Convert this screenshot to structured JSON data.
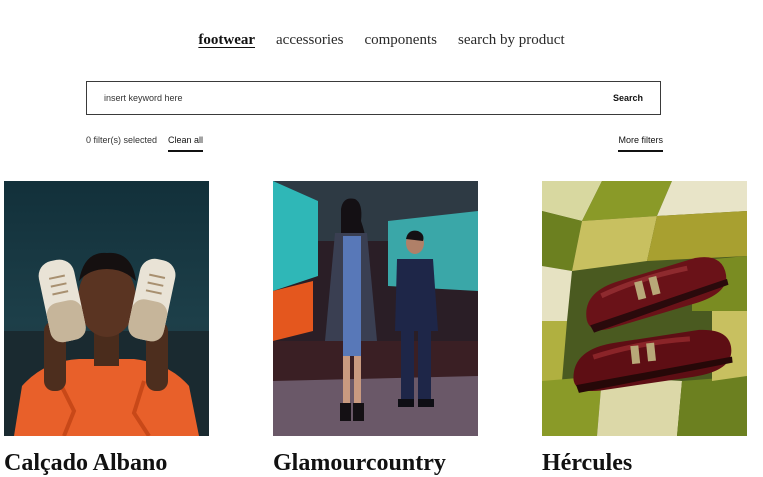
{
  "nav": {
    "items": [
      {
        "label": "footwear",
        "active": true
      },
      {
        "label": "accessories",
        "active": false
      },
      {
        "label": "components",
        "active": false
      },
      {
        "label": "search by product",
        "active": false
      }
    ]
  },
  "search": {
    "placeholder": "insert keyword here",
    "button_label": "Search"
  },
  "filters": {
    "selected_text": "0 filter(s) selected",
    "clean_all_label": "Clean all",
    "more_filters_label": "More filters"
  },
  "brands": [
    {
      "name": "Calçado Albano",
      "image": "man-holding-sneakers-photo"
    },
    {
      "name": "Glamourcountry",
      "image": "fashion-models-photo"
    },
    {
      "name": "Hércules",
      "image": "burgundy-monk-shoes-photo"
    }
  ]
}
